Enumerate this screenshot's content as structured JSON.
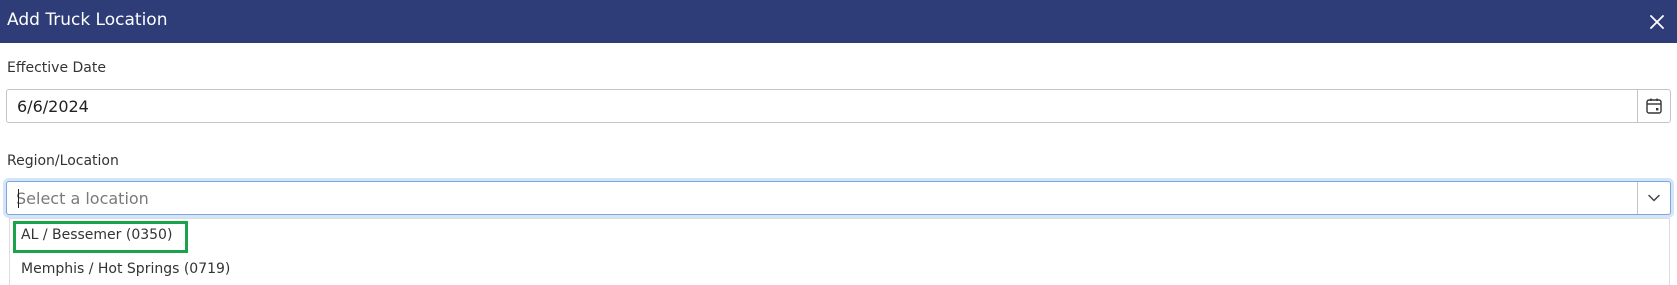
{
  "dialog": {
    "title": "Add Truck Location",
    "close_icon": "close-icon"
  },
  "effective_date": {
    "label": "Effective Date",
    "value": "6/6/2024",
    "icon": "calendar-icon"
  },
  "region_location": {
    "label": "Region/Location",
    "placeholder": "Select a location",
    "value": "",
    "icon": "chevron-down-icon",
    "options": [
      {
        "label": "AL / Bessemer (0350)",
        "highlighted": true
      },
      {
        "label": "Memphis / Hot Springs (0719)",
        "highlighted": false
      }
    ]
  },
  "colors": {
    "header": "#2e3d78",
    "highlight": "#1aa34a",
    "focus_border": "#7aa6e3"
  }
}
